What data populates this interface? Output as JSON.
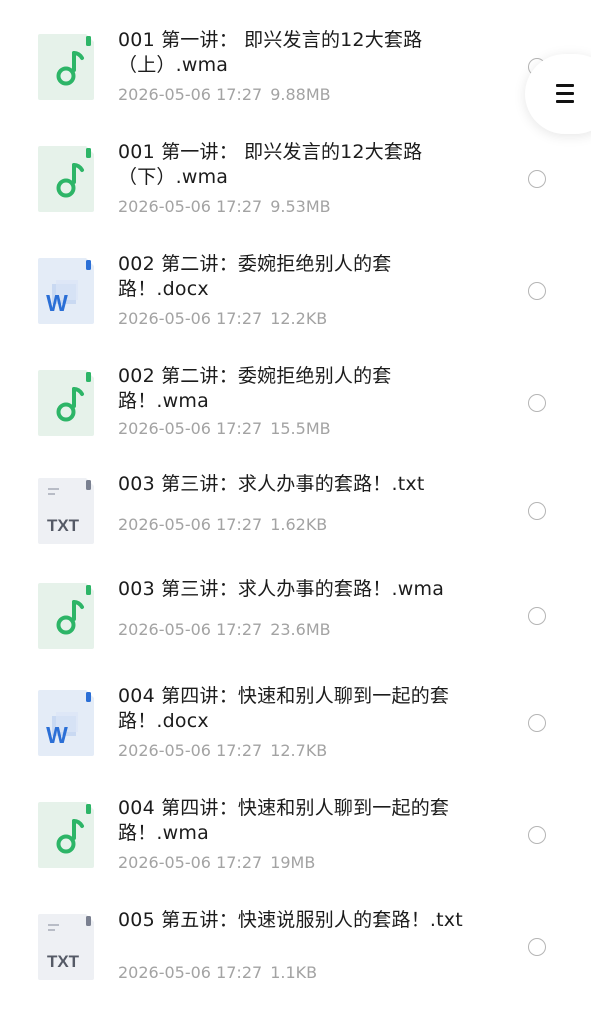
{
  "menu_button": {
    "icon": "hamburger-menu-icon"
  },
  "files": [
    {
      "type": "audio",
      "icon": "music-file-icon",
      "name": "001 第一讲： 即兴发言的12大套路（上）.wma",
      "date": "2026-05-06 17:27",
      "size": "9.88MB"
    },
    {
      "type": "audio",
      "icon": "music-file-icon",
      "name": "001 第一讲： 即兴发言的12大套路（下）.wma",
      "date": "2026-05-06 17:27",
      "size": "9.53MB"
    },
    {
      "type": "word",
      "icon": "word-document-icon",
      "icon_label": "W",
      "name": "002 第二讲：委婉拒绝别人的套路！.docx",
      "date": "2026-05-06 17:27",
      "size": "12.2KB"
    },
    {
      "type": "audio",
      "icon": "music-file-icon",
      "name": "002 第二讲：委婉拒绝别人的套路！.wma",
      "date": "2026-05-06 17:27",
      "size": "15.5MB"
    },
    {
      "type": "txt",
      "icon": "text-file-icon",
      "icon_label": "TXT",
      "name": "003 第三讲：求人办事的套路！.txt",
      "date": "2026-05-06 17:27",
      "size": "1.62KB"
    },
    {
      "type": "audio",
      "icon": "music-file-icon",
      "name": "003 第三讲：求人办事的套路！.wma",
      "date": "2026-05-06 17:27",
      "size": "23.6MB"
    },
    {
      "type": "word",
      "icon": "word-document-icon",
      "icon_label": "W",
      "name": "004 第四讲：快速和别人聊到一起的套路！.docx",
      "date": "2026-05-06 17:27",
      "size": "12.7KB"
    },
    {
      "type": "audio",
      "icon": "music-file-icon",
      "name": "004 第四讲：快速和别人聊到一起的套路！.wma",
      "date": "2026-05-06 17:27",
      "size": "19MB"
    },
    {
      "type": "txt",
      "icon": "text-file-icon",
      "icon_label": "TXT",
      "name": "005 第五讲：快速说服别人的套路！.txt",
      "date": "2026-05-06 17:27",
      "size": "1.1KB"
    }
  ],
  "colors": {
    "audio_icon_bg": "#e6f2ea",
    "audio_icon_accent": "#2db567",
    "word_icon_bg": "#e4ecf7",
    "word_icon_accent": "#2b6fd6",
    "txt_icon_bg": "#eef0f4",
    "txt_icon_text": "#555a66"
  }
}
